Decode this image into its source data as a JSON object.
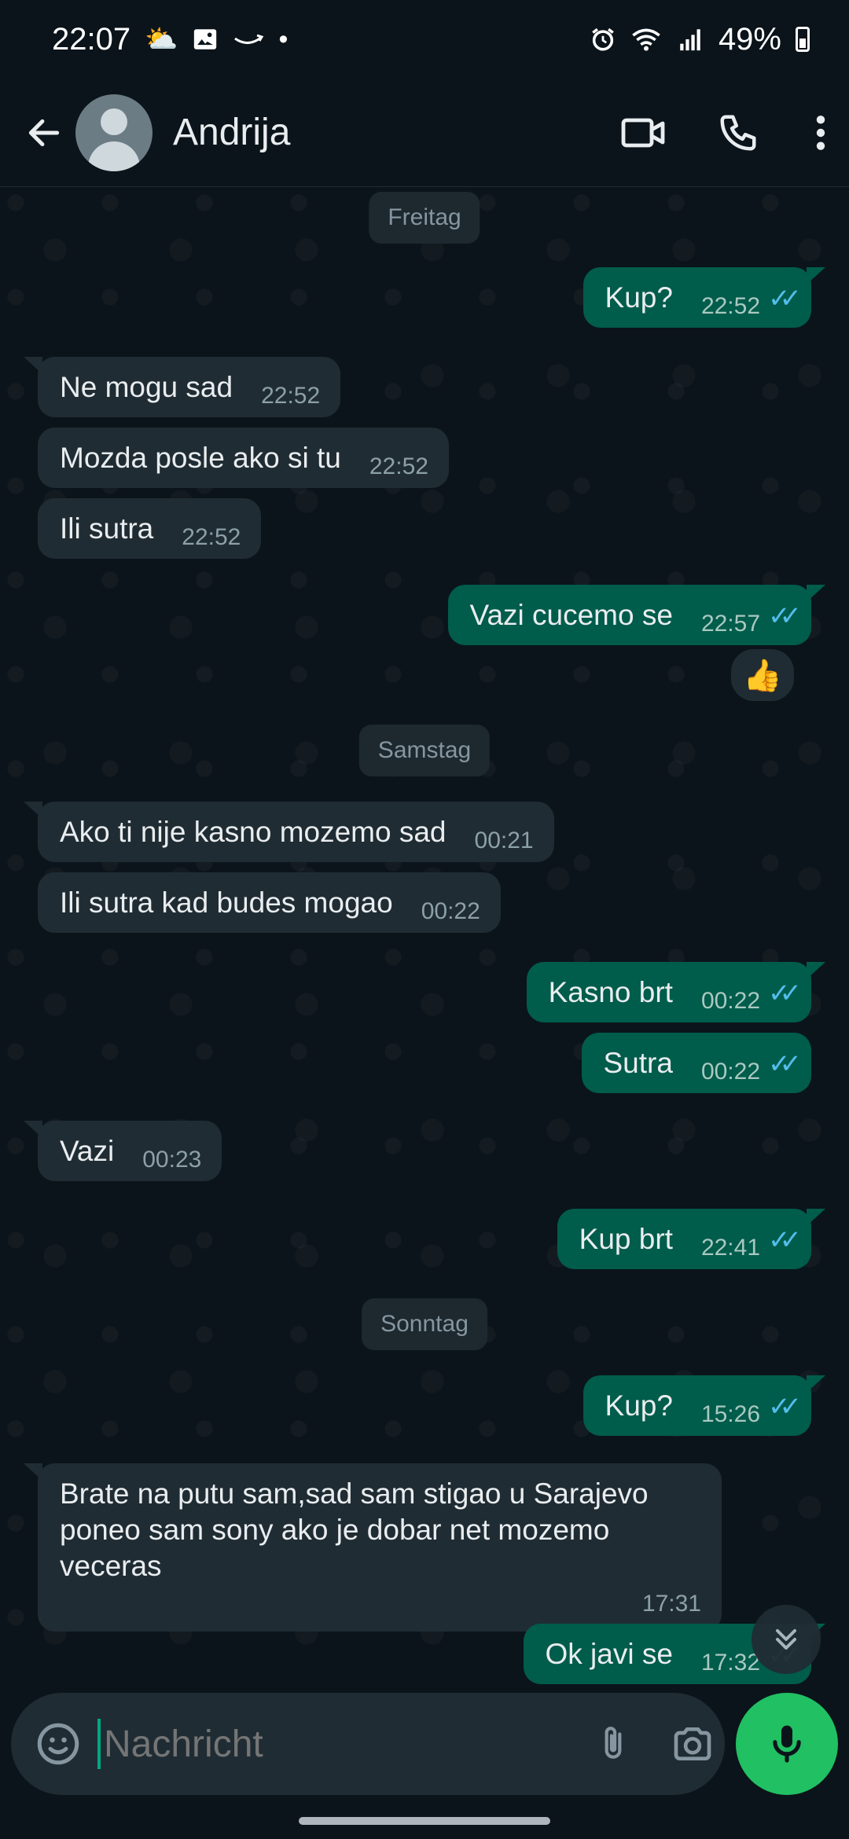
{
  "status_bar": {
    "time": "22:07",
    "battery": "49%",
    "left_icons": [
      "weather-icon",
      "gallery-icon",
      "amazon-icon",
      "dot-icon"
    ],
    "right_icons": [
      "alarm-icon",
      "wifi-icon",
      "signal-icon",
      "battery-icon"
    ]
  },
  "header": {
    "contact_name": "Andrija",
    "icons": [
      "back-arrow-icon",
      "avatar",
      "video-call-icon",
      "phone-icon",
      "more-options-icon"
    ]
  },
  "days": {
    "d1": "Freitag",
    "d2": "Samstag",
    "d3": "Sonntag"
  },
  "messages": {
    "m1": {
      "text": "Kup?",
      "time": "22:52",
      "dir": "out"
    },
    "m2": {
      "text": "Ne mogu sad",
      "time": "22:52",
      "dir": "in"
    },
    "m3": {
      "text": "Mozda posle ako si tu",
      "time": "22:52",
      "dir": "in"
    },
    "m4": {
      "text": "Ili sutra",
      "time": "22:52",
      "dir": "in"
    },
    "m5": {
      "text": "Vazi cucemo se",
      "time": "22:57",
      "dir": "out",
      "reaction": "👍"
    },
    "m6": {
      "text": "Ako ti nije kasno mozemo sad",
      "time": "00:21",
      "dir": "in"
    },
    "m7": {
      "text": "Ili sutra kad budes mogao",
      "time": "00:22",
      "dir": "in"
    },
    "m8": {
      "text": "Kasno brt",
      "time": "00:22",
      "dir": "out"
    },
    "m9": {
      "text": "Sutra",
      "time": "00:22",
      "dir": "out"
    },
    "m10": {
      "text": "Vazi",
      "time": "00:23",
      "dir": "in"
    },
    "m11": {
      "text": "Kup brt",
      "time": "22:41",
      "dir": "out"
    },
    "m12": {
      "text": "Kup?",
      "time": "15:26",
      "dir": "out"
    },
    "m13": {
      "text": "Brate na putu sam,sad sam stigao u Sarajevo poneo sam sony ako je dobar net mozemo veceras",
      "time": "17:31",
      "dir": "in"
    },
    "m14": {
      "text": "Ok javi se",
      "time": "17:32",
      "dir": "out"
    }
  },
  "read_ticks": "✓✓",
  "composer": {
    "placeholder": "Nachricht",
    "icons": [
      "emoji-icon",
      "attach-icon",
      "camera-icon",
      "mic-icon"
    ]
  },
  "colors": {
    "background": "#0b141a",
    "incoming_bubble": "#202c33",
    "outgoing_bubble": "#005c4b",
    "read_tick": "#53bdeb",
    "mic_button": "#21c063"
  }
}
